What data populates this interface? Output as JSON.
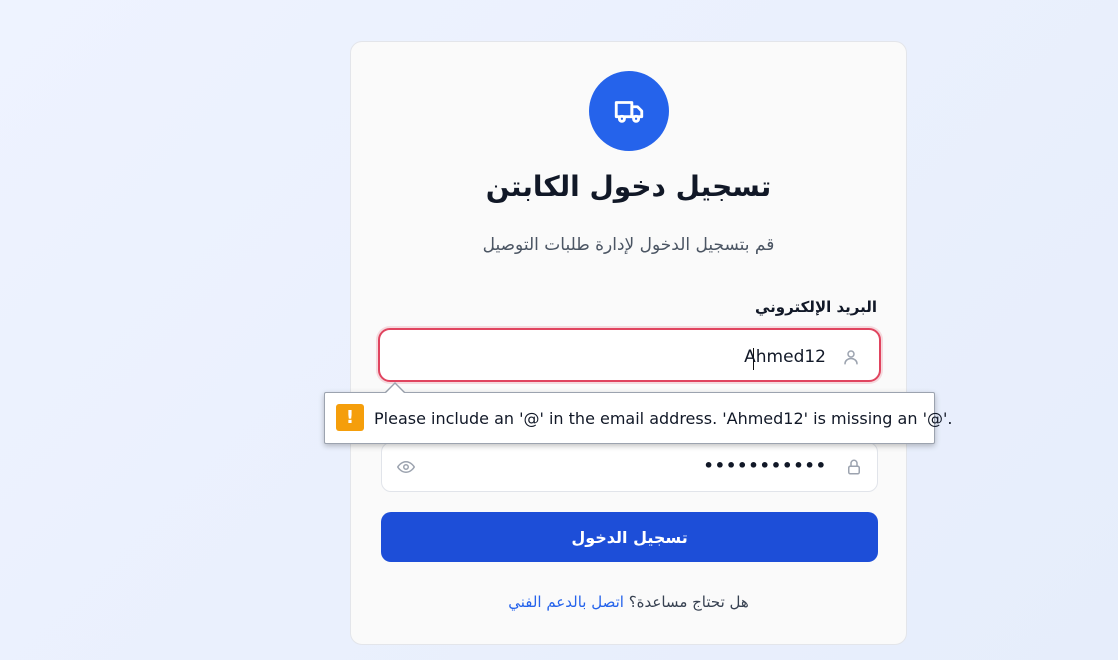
{
  "header": {
    "title": "تسجيل دخول الكابتن",
    "subtitle": "قم بتسجيل الدخول لإدارة طلبات التوصيل"
  },
  "form": {
    "email_label": "البريد الإلكتروني",
    "email_value": "Ahmed12",
    "password_value": "•••••••••••",
    "submit_label": "تسجيل الدخول"
  },
  "validation": {
    "message": "Please include an '@' in the email address. 'Ahmed12' is missing an '@'.",
    "icon": "warning-icon"
  },
  "help": {
    "question": "هل تحتاج مساعدة؟",
    "link": "اتصل بالدعم الفني"
  },
  "colors": {
    "primary": "#2563eb",
    "button": "#1d4ed8",
    "error_border": "#e0445f",
    "warning": "#f59e0b"
  },
  "icons": {
    "logo": "truck-icon",
    "email": "user-icon",
    "password": "lock-icon",
    "toggle_visibility": "eye-icon"
  }
}
